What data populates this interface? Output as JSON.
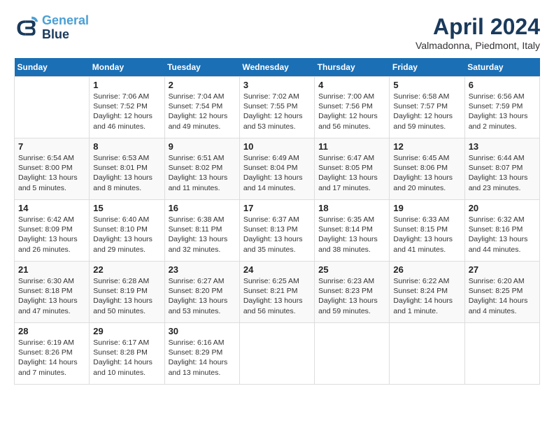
{
  "header": {
    "logo_line1": "General",
    "logo_line2": "Blue",
    "month": "April 2024",
    "location": "Valmadonna, Piedmont, Italy"
  },
  "weekdays": [
    "Sunday",
    "Monday",
    "Tuesday",
    "Wednesday",
    "Thursday",
    "Friday",
    "Saturday"
  ],
  "weeks": [
    [
      {
        "day": "",
        "text": ""
      },
      {
        "day": "1",
        "text": "Sunrise: 7:06 AM\nSunset: 7:52 PM\nDaylight: 12 hours\nand 46 minutes."
      },
      {
        "day": "2",
        "text": "Sunrise: 7:04 AM\nSunset: 7:54 PM\nDaylight: 12 hours\nand 49 minutes."
      },
      {
        "day": "3",
        "text": "Sunrise: 7:02 AM\nSunset: 7:55 PM\nDaylight: 12 hours\nand 53 minutes."
      },
      {
        "day": "4",
        "text": "Sunrise: 7:00 AM\nSunset: 7:56 PM\nDaylight: 12 hours\nand 56 minutes."
      },
      {
        "day": "5",
        "text": "Sunrise: 6:58 AM\nSunset: 7:57 PM\nDaylight: 12 hours\nand 59 minutes."
      },
      {
        "day": "6",
        "text": "Sunrise: 6:56 AM\nSunset: 7:59 PM\nDaylight: 13 hours\nand 2 minutes."
      }
    ],
    [
      {
        "day": "7",
        "text": "Sunrise: 6:54 AM\nSunset: 8:00 PM\nDaylight: 13 hours\nand 5 minutes."
      },
      {
        "day": "8",
        "text": "Sunrise: 6:53 AM\nSunset: 8:01 PM\nDaylight: 13 hours\nand 8 minutes."
      },
      {
        "day": "9",
        "text": "Sunrise: 6:51 AM\nSunset: 8:02 PM\nDaylight: 13 hours\nand 11 minutes."
      },
      {
        "day": "10",
        "text": "Sunrise: 6:49 AM\nSunset: 8:04 PM\nDaylight: 13 hours\nand 14 minutes."
      },
      {
        "day": "11",
        "text": "Sunrise: 6:47 AM\nSunset: 8:05 PM\nDaylight: 13 hours\nand 17 minutes."
      },
      {
        "day": "12",
        "text": "Sunrise: 6:45 AM\nSunset: 8:06 PM\nDaylight: 13 hours\nand 20 minutes."
      },
      {
        "day": "13",
        "text": "Sunrise: 6:44 AM\nSunset: 8:07 PM\nDaylight: 13 hours\nand 23 minutes."
      }
    ],
    [
      {
        "day": "14",
        "text": "Sunrise: 6:42 AM\nSunset: 8:09 PM\nDaylight: 13 hours\nand 26 minutes."
      },
      {
        "day": "15",
        "text": "Sunrise: 6:40 AM\nSunset: 8:10 PM\nDaylight: 13 hours\nand 29 minutes."
      },
      {
        "day": "16",
        "text": "Sunrise: 6:38 AM\nSunset: 8:11 PM\nDaylight: 13 hours\nand 32 minutes."
      },
      {
        "day": "17",
        "text": "Sunrise: 6:37 AM\nSunset: 8:13 PM\nDaylight: 13 hours\nand 35 minutes."
      },
      {
        "day": "18",
        "text": "Sunrise: 6:35 AM\nSunset: 8:14 PM\nDaylight: 13 hours\nand 38 minutes."
      },
      {
        "day": "19",
        "text": "Sunrise: 6:33 AM\nSunset: 8:15 PM\nDaylight: 13 hours\nand 41 minutes."
      },
      {
        "day": "20",
        "text": "Sunrise: 6:32 AM\nSunset: 8:16 PM\nDaylight: 13 hours\nand 44 minutes."
      }
    ],
    [
      {
        "day": "21",
        "text": "Sunrise: 6:30 AM\nSunset: 8:18 PM\nDaylight: 13 hours\nand 47 minutes."
      },
      {
        "day": "22",
        "text": "Sunrise: 6:28 AM\nSunset: 8:19 PM\nDaylight: 13 hours\nand 50 minutes."
      },
      {
        "day": "23",
        "text": "Sunrise: 6:27 AM\nSunset: 8:20 PM\nDaylight: 13 hours\nand 53 minutes."
      },
      {
        "day": "24",
        "text": "Sunrise: 6:25 AM\nSunset: 8:21 PM\nDaylight: 13 hours\nand 56 minutes."
      },
      {
        "day": "25",
        "text": "Sunrise: 6:23 AM\nSunset: 8:23 PM\nDaylight: 13 hours\nand 59 minutes."
      },
      {
        "day": "26",
        "text": "Sunrise: 6:22 AM\nSunset: 8:24 PM\nDaylight: 14 hours\nand 1 minute."
      },
      {
        "day": "27",
        "text": "Sunrise: 6:20 AM\nSunset: 8:25 PM\nDaylight: 14 hours\nand 4 minutes."
      }
    ],
    [
      {
        "day": "28",
        "text": "Sunrise: 6:19 AM\nSunset: 8:26 PM\nDaylight: 14 hours\nand 7 minutes."
      },
      {
        "day": "29",
        "text": "Sunrise: 6:17 AM\nSunset: 8:28 PM\nDaylight: 14 hours\nand 10 minutes."
      },
      {
        "day": "30",
        "text": "Sunrise: 6:16 AM\nSunset: 8:29 PM\nDaylight: 14 hours\nand 13 minutes."
      },
      {
        "day": "",
        "text": ""
      },
      {
        "day": "",
        "text": ""
      },
      {
        "day": "",
        "text": ""
      },
      {
        "day": "",
        "text": ""
      }
    ]
  ]
}
